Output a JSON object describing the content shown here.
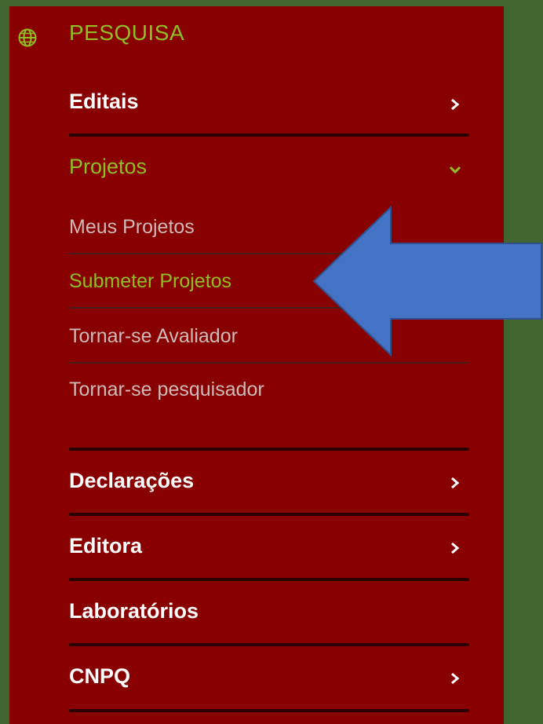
{
  "colors": {
    "background": "#416531",
    "panel": "#890000",
    "active_text": "#8fbf24",
    "primary_text": "#ffffff",
    "submenu_text": "#cfb9b9",
    "arrow": "#4472c4"
  },
  "section": {
    "icon": "globe-icon",
    "title": "PESQUISA"
  },
  "menu": {
    "editais": "Editais",
    "projetos": "Projetos",
    "declaracoes": "Declarações",
    "editora": "Editora",
    "laboratorios": "Laboratórios",
    "cnpq": "CNPQ"
  },
  "submenu": {
    "meus_projetos": "Meus Projetos",
    "submeter_projetos": "Submeter Projetos",
    "avaliador": "Tornar-se Avaliador",
    "pesquisador": "Tornar-se pesquisador"
  },
  "icons": {
    "collapsed": "chevron-right-icon",
    "expanded": "chevron-down-icon",
    "annotation": "arrow-left-icon"
  }
}
